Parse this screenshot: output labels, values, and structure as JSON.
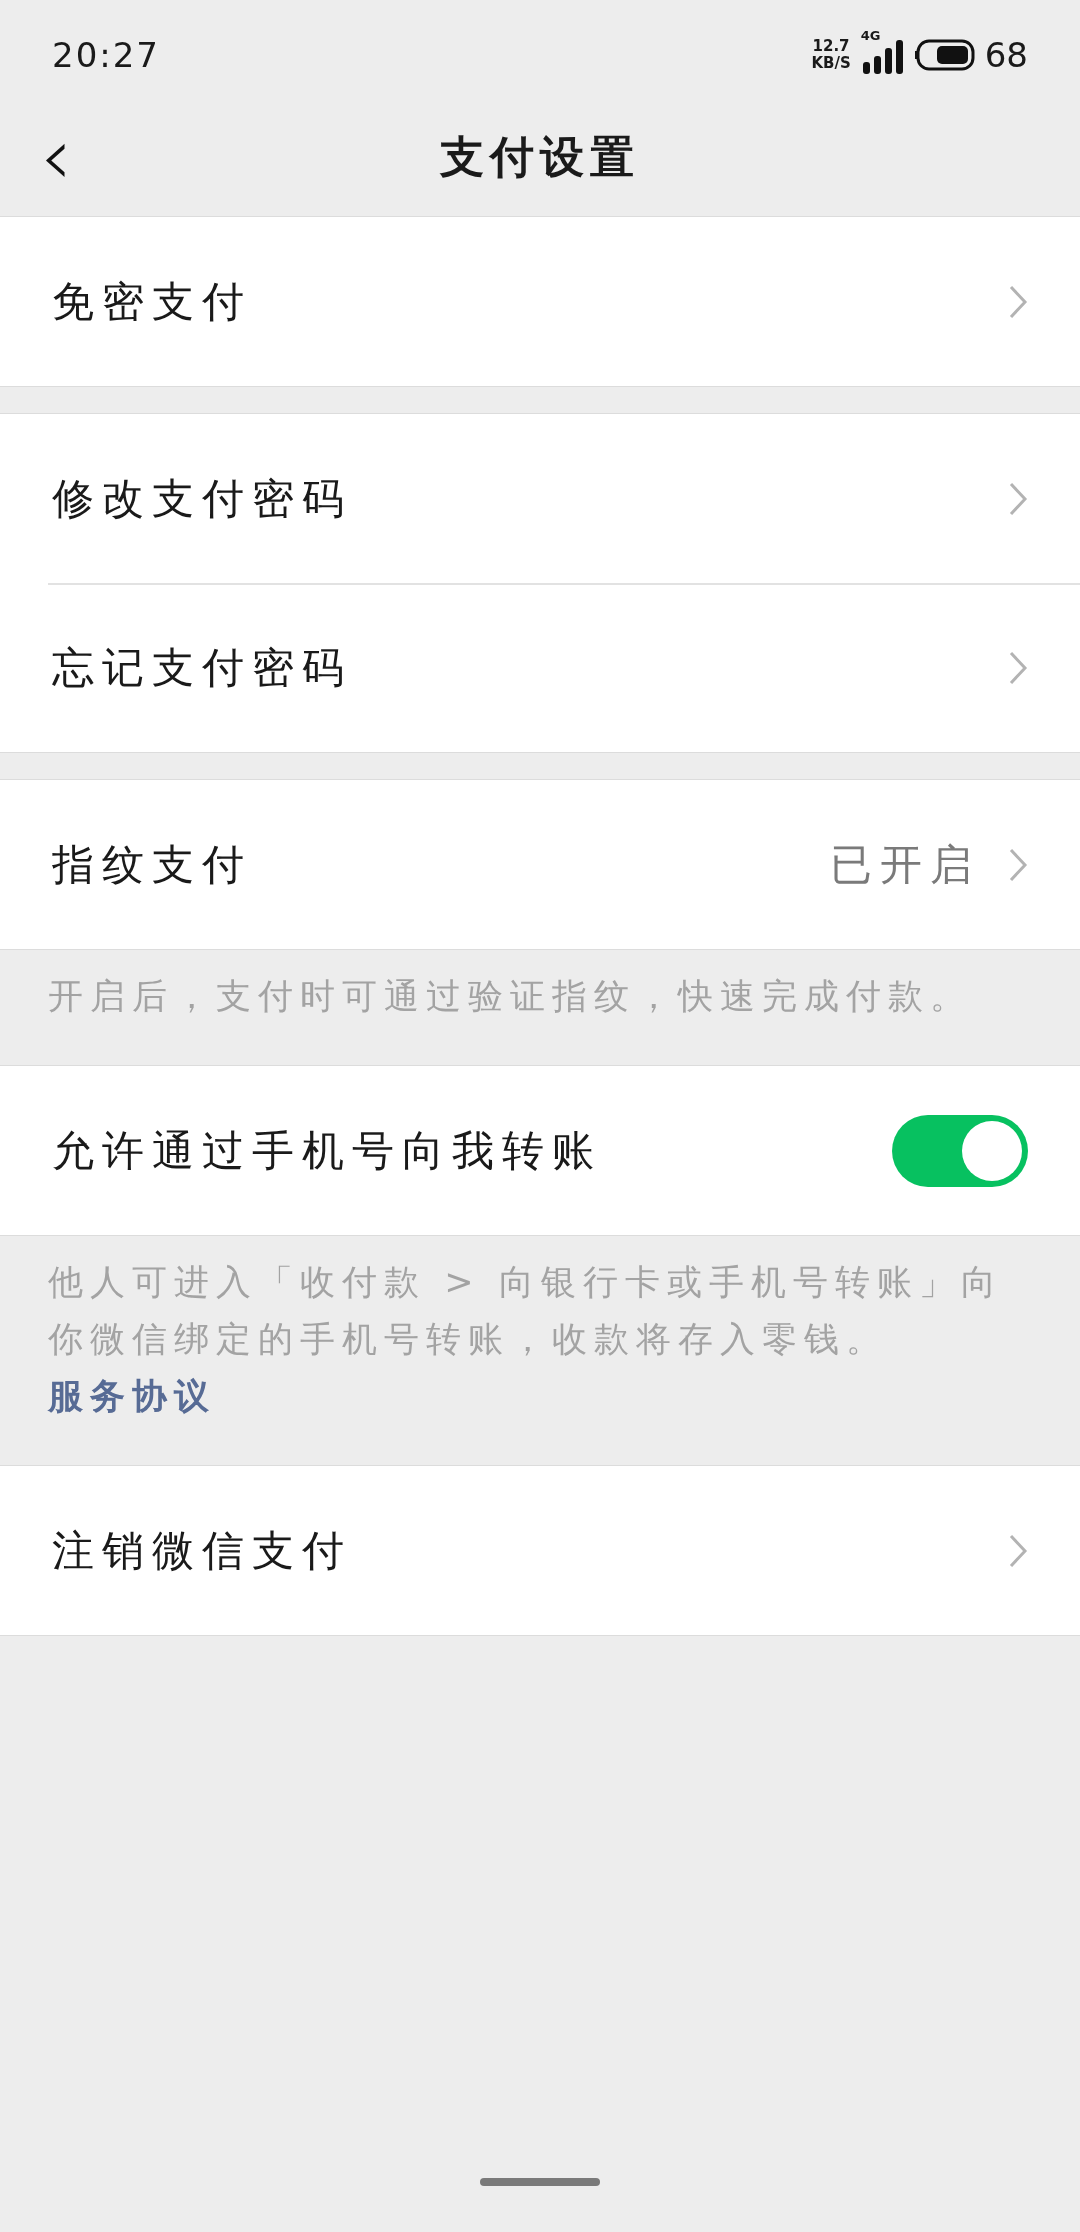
{
  "status_bar": {
    "time": "20:27",
    "speed": "12.7",
    "speed_unit": "KB/S",
    "network": "4G",
    "battery": "68"
  },
  "header": {
    "back": "‹",
    "title": "支付设置"
  },
  "groups": [
    {
      "rows": [
        {
          "kind": "link",
          "label": "免密支付"
        }
      ]
    },
    {
      "rows": [
        {
          "kind": "link",
          "label": "修改支付密码"
        },
        {
          "kind": "link",
          "label": "忘记支付密码"
        }
      ]
    },
    {
      "rows": [
        {
          "kind": "link",
          "label": "指纹支付",
          "value": "已开启"
        }
      ],
      "note": "开启后，支付时可通过验证指纹，快速完成付款。"
    },
    {
      "rows": [
        {
          "kind": "toggle",
          "label": "允许通过手机号向我转账",
          "on": true
        }
      ],
      "note": "他人可进入「收付款 > 向银行卡或手机号转账」向你微信绑定的手机号转账，收款将存入零钱。",
      "note_link": "服务协议"
    },
    {
      "rows": [
        {
          "kind": "link",
          "label": "注销微信支付"
        }
      ]
    }
  ]
}
